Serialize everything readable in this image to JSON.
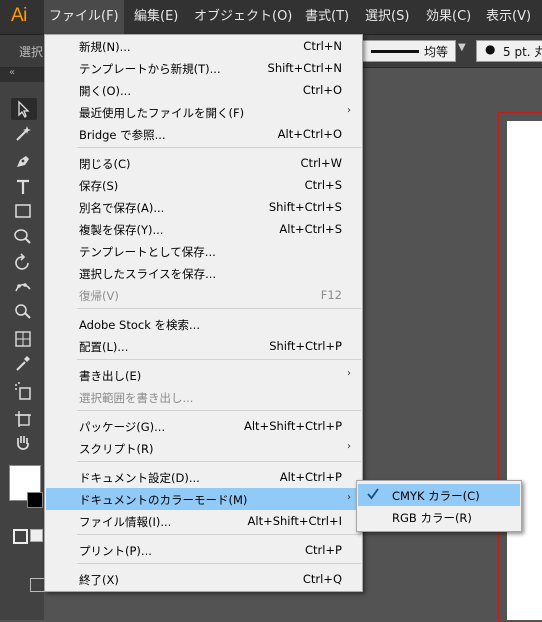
{
  "app": {
    "logo": "Ai"
  },
  "menubar": [
    {
      "label": "ファイル(F)",
      "active": true
    },
    {
      "label": "編集(E)"
    },
    {
      "label": "オブジェクト(O)"
    },
    {
      "label": "書式(T)"
    },
    {
      "label": "選択(S)"
    },
    {
      "label": "効果(C)"
    },
    {
      "label": "表示(V)"
    }
  ],
  "controlbar": {
    "select_label": "選択",
    "stroke_profile": "均等",
    "brush_size": "5 pt. 丸"
  },
  "file_menu": [
    {
      "label": "新規(N)...",
      "shortcut": "Ctrl+N"
    },
    {
      "label": "テンプレートから新規(T)...",
      "shortcut": "Shift+Ctrl+N"
    },
    {
      "label": "開く(O)...",
      "shortcut": "Ctrl+O"
    },
    {
      "label": "最近使用したファイルを開く(F)",
      "shortcut": "",
      "submenu": true
    },
    {
      "label": "Bridge で参照...",
      "shortcut": "Alt+Ctrl+O"
    },
    {
      "label": "閉じる(C)",
      "shortcut": "Ctrl+W"
    },
    {
      "label": "保存(S)",
      "shortcut": "Ctrl+S"
    },
    {
      "label": "別名で保存(A)...",
      "shortcut": "Shift+Ctrl+S"
    },
    {
      "label": "複製を保存(Y)...",
      "shortcut": "Alt+Ctrl+S"
    },
    {
      "label": "テンプレートとして保存...",
      "shortcut": ""
    },
    {
      "label": "選択したスライスを保存...",
      "shortcut": ""
    },
    {
      "label": "復帰(V)",
      "shortcut": "F12",
      "disabled": true
    },
    {
      "label": "Adobe Stock を検索...",
      "shortcut": ""
    },
    {
      "label": "配置(L)...",
      "shortcut": "Shift+Ctrl+P"
    },
    {
      "label": "書き出し(E)",
      "shortcut": "",
      "submenu": true
    },
    {
      "label": "選択範囲を書き出し...",
      "shortcut": "",
      "disabled": true
    },
    {
      "label": "パッケージ(G)...",
      "shortcut": "Alt+Shift+Ctrl+P"
    },
    {
      "label": "スクリプト(R)",
      "shortcut": "",
      "submenu": true
    },
    {
      "label": "ドキュメント設定(D)...",
      "shortcut": "Alt+Ctrl+P"
    },
    {
      "label": "ドキュメントのカラーモード(M)",
      "shortcut": "",
      "submenu": true,
      "highlighted": true
    },
    {
      "label": "ファイル情報(I)...",
      "shortcut": "Alt+Shift+Ctrl+I"
    },
    {
      "label": "プリント(P)...",
      "shortcut": "Ctrl+P"
    },
    {
      "label": "終了(X)",
      "shortcut": "Ctrl+Q"
    }
  ],
  "color_mode_submenu": [
    {
      "label": "CMYK カラー(C)",
      "checked": true,
      "highlighted": true
    },
    {
      "label": "RGB カラー(R)",
      "checked": false
    }
  ],
  "colors": {
    "menubar_bg": "#323232",
    "menu_bg": "#f0f0f0",
    "menu_highlight": "#91c9f7",
    "logo": "#ff9a00",
    "artboard_border": "#c41c1c"
  },
  "icons": {
    "submenu_arrow": "chevron-right-icon",
    "check": "check-icon",
    "collapse": "double-chevron-left-icon"
  }
}
